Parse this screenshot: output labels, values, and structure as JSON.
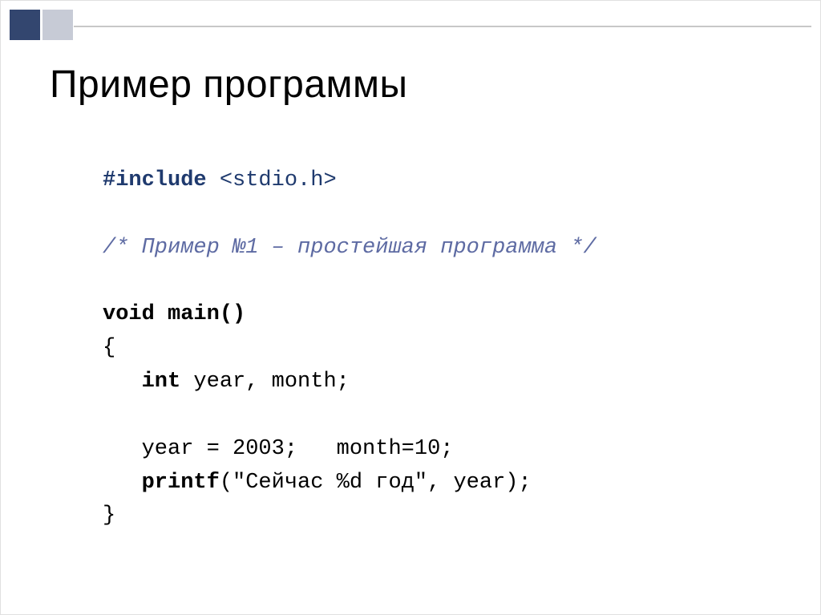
{
  "title": "Пример программы",
  "code": {
    "include_directive": "#include",
    "include_header": "<stdio.h>",
    "comment": "/* Пример №1 – простейшая программа */",
    "void_kw": "void",
    "main_decl": "main()",
    "open_brace": "{",
    "int_kw": "int",
    "var_decl": "year, month;",
    "assign_line": "   year = 2003;   month=10;",
    "printf_fn": "printf",
    "printf_args": "(\"Сейчас %d год\", year);",
    "close_brace": "}"
  }
}
